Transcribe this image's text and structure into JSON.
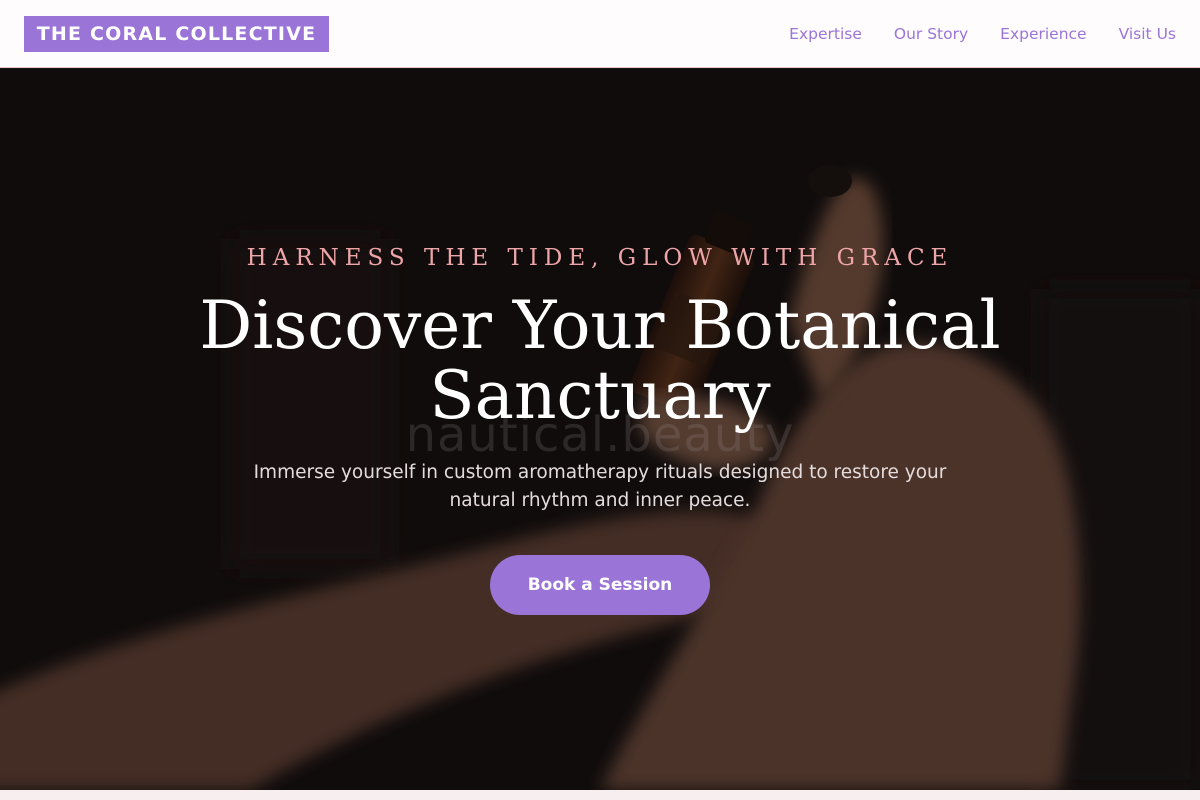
{
  "header": {
    "brand": "THE CORAL COLLECTIVE",
    "nav": [
      {
        "label": "Expertise"
      },
      {
        "label": "Our Story"
      },
      {
        "label": "Experience"
      },
      {
        "label": "Visit Us"
      }
    ]
  },
  "hero": {
    "tagline": "HARNESS THE TIDE, GLOW WITH GRACE",
    "headline": "Discover Your Botanical Sanctuary",
    "subtext": "Immerse yourself in custom aromatherapy rituals designed to restore your natural rhythm and inner peace.",
    "cta_label": "Book a Session",
    "watermark": "nautical.beauty"
  },
  "colors": {
    "accent": "#9b74d8",
    "tagline": "#eda5a8",
    "header_bg": "#fefcfd"
  }
}
